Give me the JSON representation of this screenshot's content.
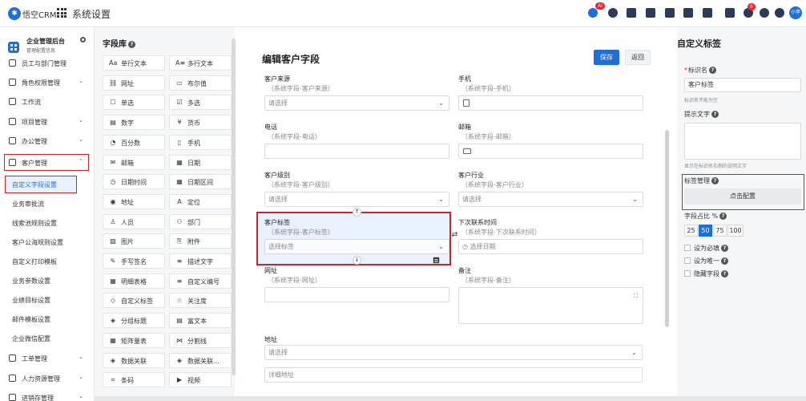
{
  "topbar": {
    "logo_text": "悟空CRM",
    "app_title": "系统设置",
    "badge_ai": "AI",
    "badge_notify": "6",
    "user_initials": "小李"
  },
  "sidebar": {
    "header_title": "企业管理后台",
    "header_sub": "管理配置信息",
    "items": [
      {
        "label": "员工与部门管理"
      },
      {
        "label": "角色权限管理",
        "chev": "⌄"
      },
      {
        "label": "工作流"
      },
      {
        "label": "项目管理",
        "chev": "⌄"
      },
      {
        "label": "办公管理",
        "chev": "⌄"
      },
      {
        "label": "客户管理",
        "chev": "⌃"
      },
      {
        "label": "工单管理",
        "chev": "⌄"
      },
      {
        "label": "人力资源管理",
        "chev": "⌄"
      },
      {
        "label": "进销存管理",
        "chev": "⌄"
      }
    ],
    "sub_items": [
      {
        "label": "自定义字段设置"
      },
      {
        "label": "业务审批流"
      },
      {
        "label": "线索池规则设置"
      },
      {
        "label": "客户公海规则设置"
      },
      {
        "label": "自定义打印模板"
      },
      {
        "label": "业务参数设置"
      },
      {
        "label": "业绩目标设置"
      },
      {
        "label": "邮件模板设置"
      },
      {
        "label": "企业微信配置"
      }
    ]
  },
  "library": {
    "title": "字段库",
    "items": [
      {
        "icon": "Aa",
        "label": "单行文本"
      },
      {
        "icon": "A≡",
        "label": "多行文本"
      },
      {
        "icon": "⛓",
        "label": "网址"
      },
      {
        "icon": "▭",
        "label": "布尔值"
      },
      {
        "icon": "☐",
        "label": "单选"
      },
      {
        "icon": "☑",
        "label": "多选"
      },
      {
        "icon": "▤",
        "label": "数字"
      },
      {
        "icon": "¥",
        "label": "货币"
      },
      {
        "icon": "◔",
        "label": "百分数"
      },
      {
        "icon": "▯",
        "label": "手机"
      },
      {
        "icon": "✉",
        "label": "邮箱"
      },
      {
        "icon": "▦",
        "label": "日期"
      },
      {
        "icon": "◷",
        "label": "日期时间"
      },
      {
        "icon": "▦",
        "label": "日期区间"
      },
      {
        "icon": "◉",
        "label": "地址"
      },
      {
        "icon": "A",
        "label": "定位"
      },
      {
        "icon": "♙",
        "label": "人员"
      },
      {
        "icon": "⚇",
        "label": "部门"
      },
      {
        "icon": "▨",
        "label": "图片"
      },
      {
        "icon": "⎘",
        "label": "附件"
      },
      {
        "icon": "✎",
        "label": "手写签名"
      },
      {
        "icon": "≡",
        "label": "描述文字"
      },
      {
        "icon": "▦",
        "label": "明细表格"
      },
      {
        "icon": "≡",
        "label": "自定义编号"
      },
      {
        "icon": "◇",
        "label": "自定义标签"
      },
      {
        "icon": "☆",
        "label": "关注度"
      },
      {
        "icon": "◈",
        "label": "分组标题"
      },
      {
        "icon": "▤",
        "label": "富文本"
      },
      {
        "icon": "▦",
        "label": "矩阵量表"
      },
      {
        "icon": "⋈",
        "label": "分割线"
      },
      {
        "icon": "◈",
        "label": "数据关联"
      },
      {
        "icon": "◈",
        "label": "数据关联..."
      },
      {
        "icon": "⌗",
        "label": "条码"
      },
      {
        "icon": "▶",
        "label": "视频"
      }
    ]
  },
  "form": {
    "title": "编辑客户字段",
    "save_label": "保存",
    "back_label": "返回",
    "fields": [
      {
        "label": "客户来源",
        "sub": "（系统字段-客户来源）",
        "value": "请选择",
        "chev": "⌄"
      },
      {
        "label": "手机",
        "sub": "（系统字段-手机）",
        "value": ""
      },
      {
        "label": "电话",
        "sub": "（系统字段-电话）",
        "value": ""
      },
      {
        "label": "邮箱",
        "sub": "（系统字段-邮箱）",
        "value": ""
      },
      {
        "label": "客户级别",
        "sub": "（系统字段-客户级别）",
        "value": "请选择",
        "chev": "⌄"
      },
      {
        "label": "客户行业",
        "sub": "（系统字段-客户行业）",
        "value": "请选择",
        "chev": "⌄"
      },
      {
        "label": "客户标签",
        "sub": "（系统字段-客户标签）",
        "value": "选择标签",
        "chev": "⌄"
      },
      {
        "label": "下次联系时间",
        "sub": "（系统字段-下次联系时间）",
        "value": "◷ 选择日期"
      },
      {
        "label": "网址",
        "sub": "（系统字段-网址）",
        "value": ""
      },
      {
        "label": "备注",
        "sub": "（系统字段-备注）",
        "value": ""
      },
      {
        "label": "地址",
        "value": "请选择",
        "chev": "⌄"
      },
      {
        "value": "详细地址"
      }
    ]
  },
  "right_panel": {
    "title": "自定义标签",
    "name_label": "标识名",
    "name_value": "客户标签",
    "name_hint": "标识名不能为空",
    "tip_label": "提示文字",
    "tip_hint": "显示在标识名右侧的说明文字",
    "tag_mgmt_label": "标签管理",
    "tag_mgmt_button": "点击配置",
    "pct_label": "字段占比 %",
    "pct_options": [
      "25",
      "50",
      "75",
      "100"
    ],
    "pct_selected": "50",
    "checks": [
      {
        "label": "设为必填"
      },
      {
        "label": "设为唯一"
      },
      {
        "label": "隐藏字段"
      }
    ]
  }
}
